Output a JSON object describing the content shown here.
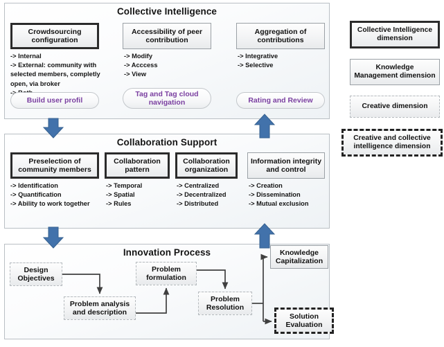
{
  "panels": [
    {
      "id": "collective-intelligence",
      "title": "Collective Intelligence",
      "boxes": [
        {
          "label": "Crowdsourcing configuration",
          "style": "collective-intelligence"
        },
        {
          "label": "Accessibility of peer contribution",
          "style": "knowledge-management"
        },
        {
          "label": "Aggregation of contributions",
          "style": "knowledge-management"
        }
      ],
      "bullets": [
        "-> Internal\n-> External: community with\nselected members, completly\nopen, via broker\n-> Both",
        "-> Modify\n-> Acccess\n-> View",
        "-> Integrative\n-> Selective"
      ],
      "pills": [
        "Build user profil",
        "Tag and Tag cloud navigation",
        "Rating and Review"
      ]
    },
    {
      "id": "collaboration-support",
      "title": "Collaboration Support",
      "boxes": [
        {
          "label": "Preselection of community members",
          "style": "collective-intelligence"
        },
        {
          "label": "Collaboration pattern",
          "style": "collective-intelligence"
        },
        {
          "label": "Collaboration organization",
          "style": "collective-intelligence"
        },
        {
          "label": "Information integrity and control",
          "style": "knowledge-management"
        }
      ],
      "bullets": [
        "-> Identification\n-> Quantification\n-> Ability to work together",
        "-> Temporal\n-> Spatial\n-> Rules",
        "-> Centralized\n-> Decentralized\n-> Distributed",
        "-> Creation\n-> Dissemination\n-> Mutual exclusion"
      ]
    },
    {
      "id": "innovation-process",
      "title": "Innovation Process",
      "nodes": [
        {
          "label": "Design Objectives",
          "style": "creative"
        },
        {
          "label": "Problem analysis and description",
          "style": "creative"
        },
        {
          "label": "Problem formulation",
          "style": "creative"
        },
        {
          "label": "Problem Resolution",
          "style": "creative"
        },
        {
          "label": "Knowledge Capitalization",
          "style": "knowledge-management"
        },
        {
          "label": "Solution Evaluation",
          "style": "creative-and-collective"
        }
      ]
    }
  ],
  "legend": {
    "items": [
      {
        "label": "Collective Intelligence dimension",
        "style": "collective-intelligence"
      },
      {
        "label": "Knowledge Management dimension",
        "style": "knowledge-management"
      },
      {
        "label": "Creative dimension",
        "style": "creative"
      },
      {
        "label": "Creative and collective intelligence dimension",
        "style": "creative-and-collective"
      }
    ]
  },
  "colors": {
    "arrow_blue": "#4272ab",
    "pill_text_purple": "#7a3fa0",
    "thick_border": "#2b2b2b",
    "thin_border": "#9aa0a5",
    "dotted_border": "#b4b9bd"
  }
}
